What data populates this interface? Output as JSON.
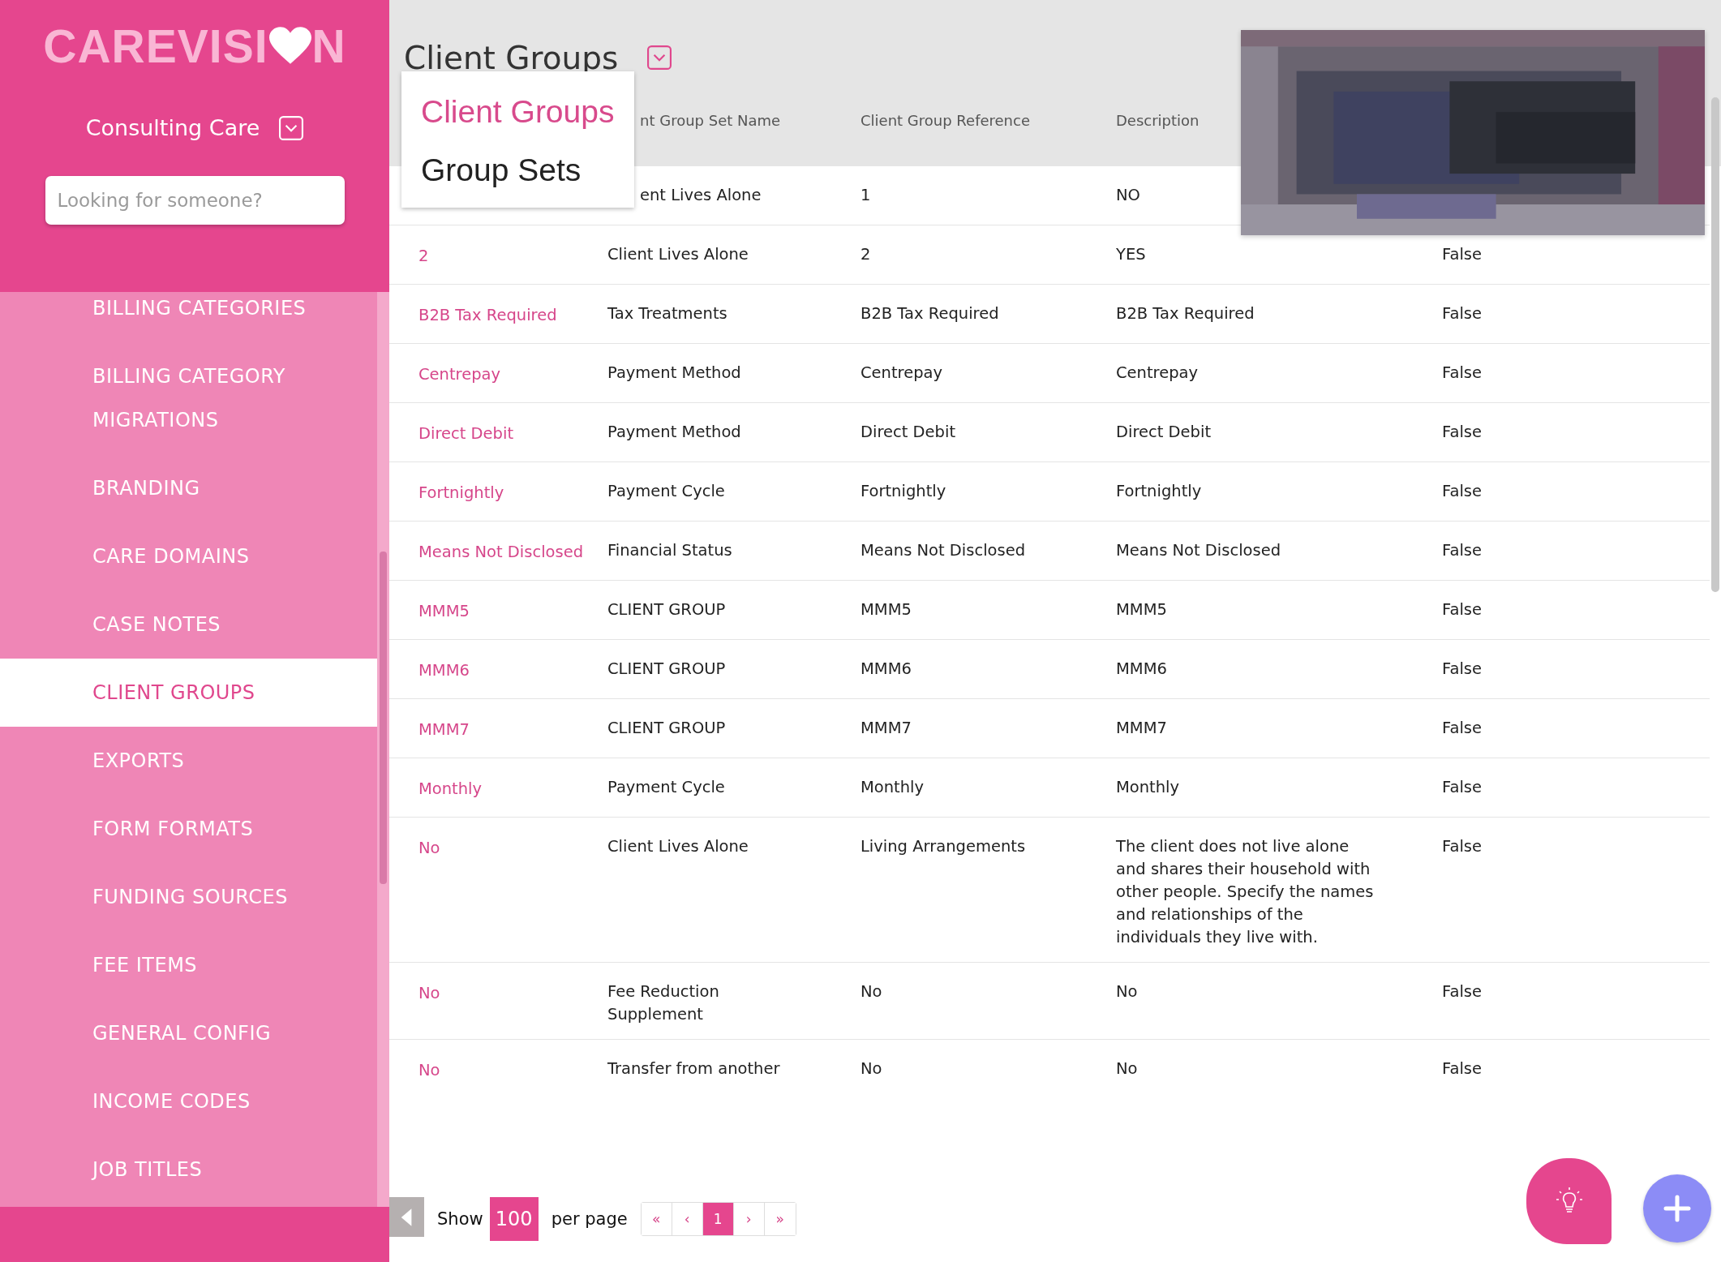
{
  "brand": {
    "logo_parts": [
      "CAREVISI",
      "N"
    ]
  },
  "organization": {
    "label": "Consulting Care"
  },
  "search": {
    "placeholder": "Looking for someone?"
  },
  "nav": [
    {
      "label": "BILLING CATEGORIES",
      "selected": false
    },
    {
      "label": "BILLING CATEGORY MIGRATIONS",
      "selected": false
    },
    {
      "label": "BRANDING",
      "selected": false
    },
    {
      "label": "CARE DOMAINS",
      "selected": false
    },
    {
      "label": "CASE NOTES",
      "selected": false
    },
    {
      "label": "CLIENT GROUPS",
      "selected": true
    },
    {
      "label": "EXPORTS",
      "selected": false
    },
    {
      "label": "FORM FORMATS",
      "selected": false
    },
    {
      "label": "FUNDING SOURCES",
      "selected": false
    },
    {
      "label": "FEE ITEMS",
      "selected": false
    },
    {
      "label": "GENERAL CONFIG",
      "selected": false
    },
    {
      "label": "INCOME CODES",
      "selected": false
    },
    {
      "label": "JOB TITLES",
      "selected": false
    }
  ],
  "page_title": "Client Groups",
  "view_menu": {
    "items": [
      {
        "label": "Client Groups",
        "selected": true
      },
      {
        "label": "Group Sets",
        "selected": false
      }
    ]
  },
  "table": {
    "columns": [
      null,
      "nt Group Set Name",
      "Client Group Reference",
      "Description",
      null
    ],
    "rows": [
      [
        null,
        "ent Lives Alone",
        "1",
        "NO",
        null
      ],
      [
        "2",
        "Client Lives Alone",
        "2",
        "YES",
        "False"
      ],
      [
        "B2B Tax Required",
        "Tax Treatments",
        "B2B Tax Required",
        "B2B Tax Required",
        "False"
      ],
      [
        "Centrepay",
        "Payment Method",
        "Centrepay",
        "Centrepay",
        "False"
      ],
      [
        "Direct Debit",
        "Payment Method",
        "Direct Debit",
        "Direct Debit",
        "False"
      ],
      [
        "Fortnightly",
        "Payment Cycle",
        "Fortnightly",
        "Fortnightly",
        "False"
      ],
      [
        "Means Not Disclosed",
        "Financial Status",
        "Means Not Disclosed",
        "Means Not Disclosed",
        "False"
      ],
      [
        "MMM5",
        "CLIENT GROUP",
        "MMM5",
        "MMM5",
        "False"
      ],
      [
        "MMM6",
        "CLIENT GROUP",
        "MMM6",
        "MMM6",
        "False"
      ],
      [
        "MMM7",
        "CLIENT GROUP",
        "MMM7",
        "MMM7",
        "False"
      ],
      [
        "Monthly",
        "Payment Cycle",
        "Monthly",
        "Monthly",
        "False"
      ],
      [
        "No",
        "Client Lives Alone",
        "Living Arrangements",
        "The client does not live alone and shares their household with other people. Specify the names and relationships of the individuals they live with.",
        "False"
      ],
      [
        "No",
        "Fee Reduction Supplement",
        "No",
        "No",
        "False"
      ],
      [
        "No",
        "Transfer from another",
        "No",
        "No",
        "False"
      ]
    ]
  },
  "pagination": {
    "show_label": "Show",
    "page_size": "100",
    "per_page_label": "per page",
    "buttons": [
      {
        "label": "«",
        "selected": false
      },
      {
        "label": "‹",
        "selected": false
      },
      {
        "label": "1",
        "selected": true
      },
      {
        "label": "›",
        "selected": false
      },
      {
        "label": "»",
        "selected": false
      }
    ]
  }
}
